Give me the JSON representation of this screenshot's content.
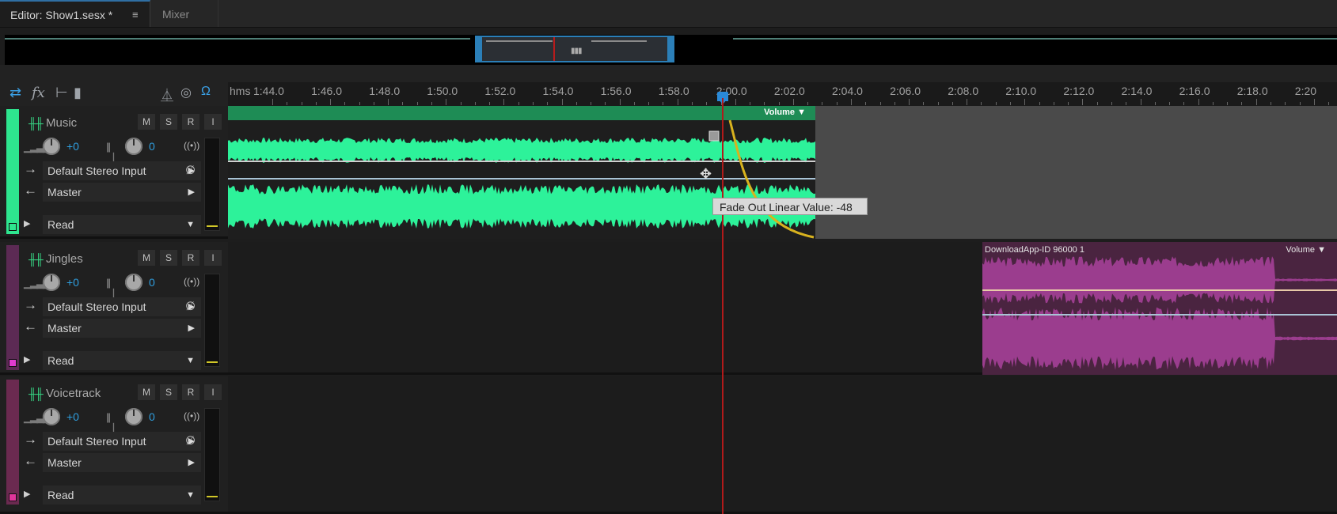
{
  "tabs": {
    "editor": "Editor: Show1.sesx *",
    "editor_menu": "≡",
    "mixer": "Mixer"
  },
  "ruler": {
    "unit": "hms",
    "labels": [
      "1:44.0",
      "1:46.0",
      "1:48.0",
      "1:50.0",
      "1:52.0",
      "1:54.0",
      "1:56.0",
      "1:58.0",
      "2:00.0",
      "2:02.0",
      "2:04.0",
      "2:06.0",
      "2:08.0",
      "2:10.0",
      "2:12.0",
      "2:14.0",
      "2:16.0",
      "2:18.0",
      "2:20"
    ]
  },
  "toolbar": {
    "icons": [
      "inputs-outputs-icon",
      "fx-icon",
      "sends-icon",
      "eq-icon",
      "metronome-icon",
      "record-punch-icon",
      "monitor-icon"
    ]
  },
  "tracks": [
    {
      "name": "Music",
      "color": "#2ee58f",
      "m": "M",
      "s": "S",
      "r": "R",
      "i": "I",
      "volume": "+0",
      "pan": "0",
      "input": "Default Stereo Input",
      "output": "Master",
      "automation": "Read"
    },
    {
      "name": "Jingles",
      "color": "#b32ea2",
      "m": "M",
      "s": "S",
      "r": "R",
      "i": "I",
      "volume": "+0",
      "pan": "0",
      "input": "Default Stereo Input",
      "output": "Master",
      "automation": "Read"
    },
    {
      "name": "Voicetrack",
      "color": "#c43a86",
      "m": "M",
      "s": "S",
      "r": "R",
      "i": "I",
      "volume": "+0",
      "pan": "0",
      "input": "Default Stereo Input",
      "output": "Master",
      "automation": "Read"
    }
  ],
  "clips": {
    "music": {
      "envelope": "Volume"
    },
    "jingle": {
      "name": "DownloadApp-ID 96000 1",
      "envelope": "Volume"
    }
  },
  "tooltip": "Fade Out Linear Value: -48"
}
